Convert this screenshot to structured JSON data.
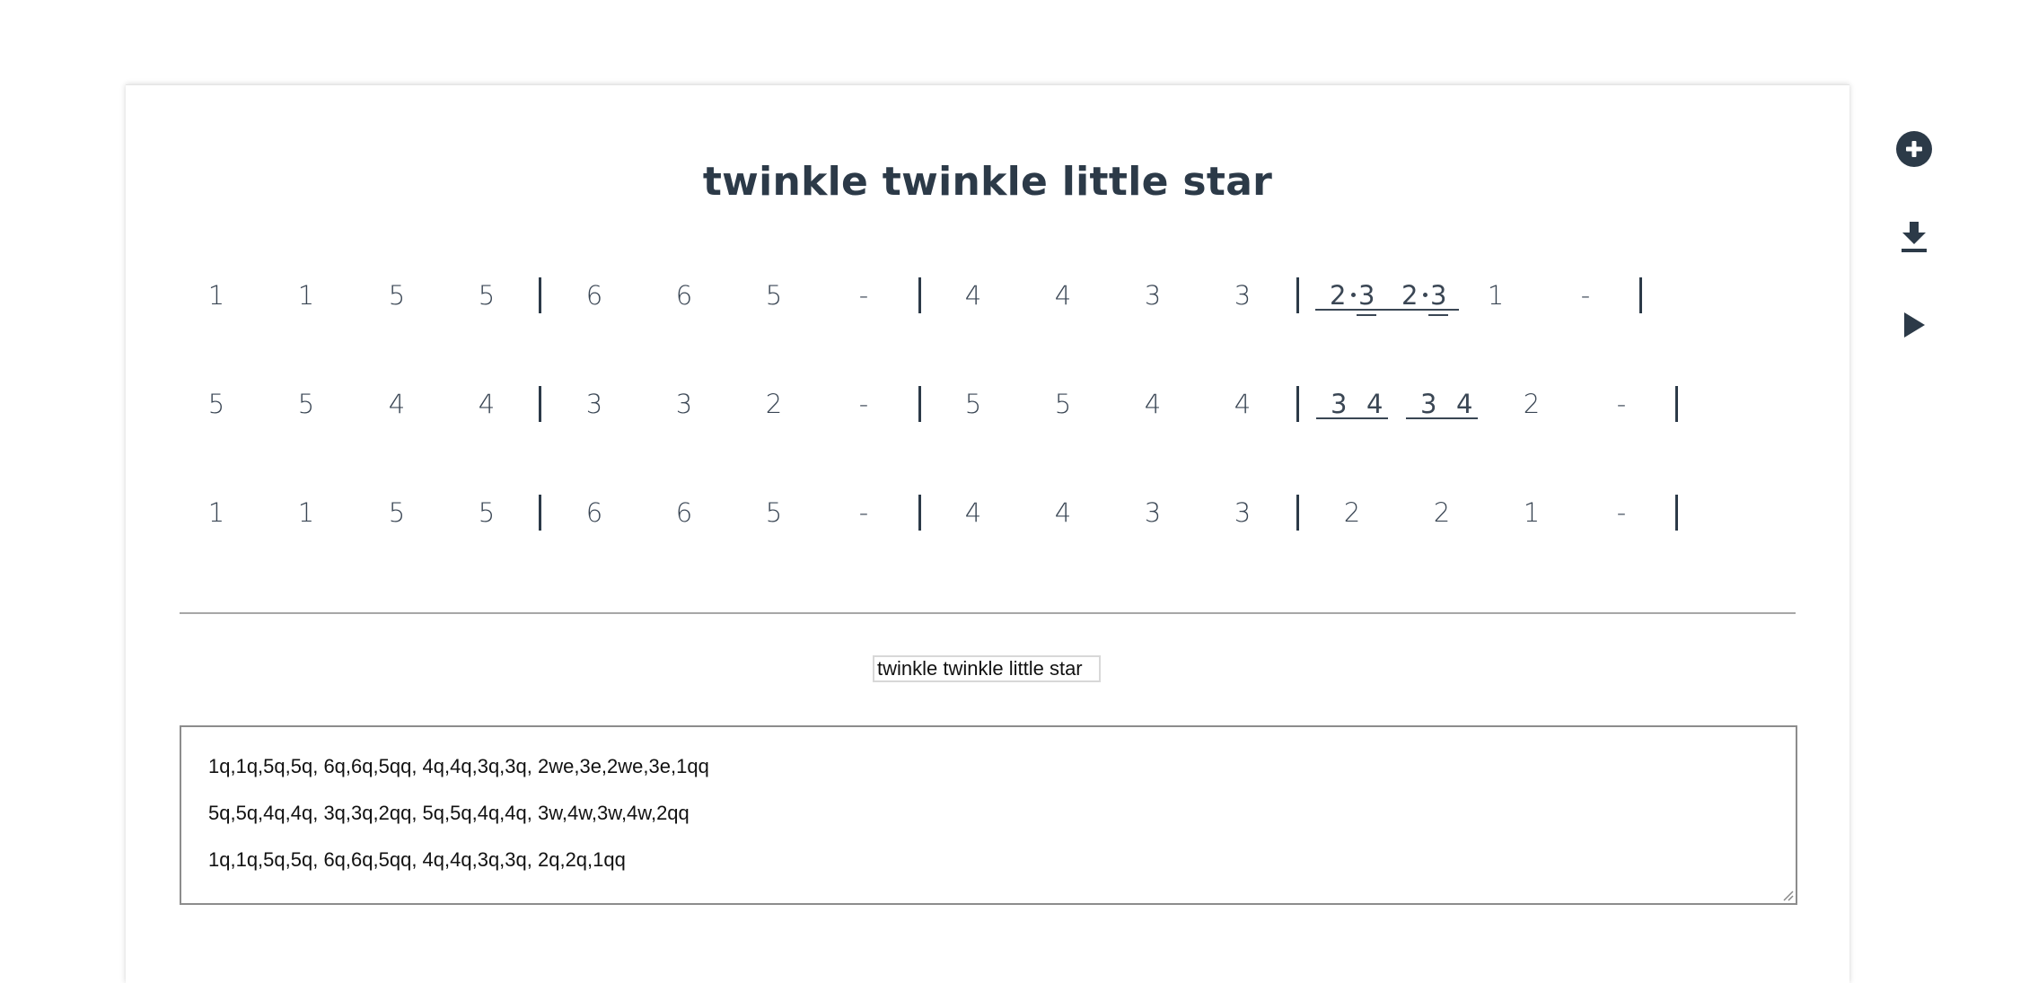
{
  "song": {
    "title": "twinkle twinkle little star",
    "name_input_value": "twinkle twinkle little star",
    "notation": {
      "line1": {
        "m1": [
          "1",
          "1",
          "5",
          "5"
        ],
        "m2": [
          "6",
          "6",
          "5",
          "-"
        ],
        "m3": [
          "4",
          "4",
          "3",
          "3"
        ],
        "m4_pairs": [
          [
            "2",
            "3"
          ],
          [
            "2",
            "3"
          ]
        ],
        "m4": [
          "1",
          "-"
        ]
      },
      "line2": {
        "m1": [
          "5",
          "5",
          "4",
          "4"
        ],
        "m2": [
          "3",
          "3",
          "2",
          "-"
        ],
        "m3": [
          "5",
          "5",
          "4",
          "4"
        ],
        "m4_pairs": [
          [
            "3",
            "4"
          ],
          [
            "3",
            "4"
          ]
        ],
        "m4": [
          "2",
          "-"
        ]
      },
      "line3": {
        "m1": [
          "1",
          "1",
          "5",
          "5"
        ],
        "m2": [
          "6",
          "6",
          "5",
          "-"
        ],
        "m3": [
          "4",
          "4",
          "3",
          "3"
        ],
        "m4": [
          "2",
          "2",
          "1",
          "-"
        ]
      }
    },
    "source_lines": [
      "1q,1q,5q,5q, 6q,6q,5qq, 4q,4q,3q,3q, 2we,3e,2we,3e,1qq",
      "5q,5q,4q,4q, 3q,3q,2qq, 5q,5q,4q,4q, 3w,4w,3w,4w,2qq",
      "1q,1q,5q,5q, 6q,6q,5qq, 4q,4q,3q,3q, 2q,2q,1qq"
    ]
  },
  "toolbar": {
    "add_icon": "plus-circle-icon",
    "download_icon": "download-icon",
    "play_icon": "play-icon",
    "icon_color": "#2c3a48"
  }
}
